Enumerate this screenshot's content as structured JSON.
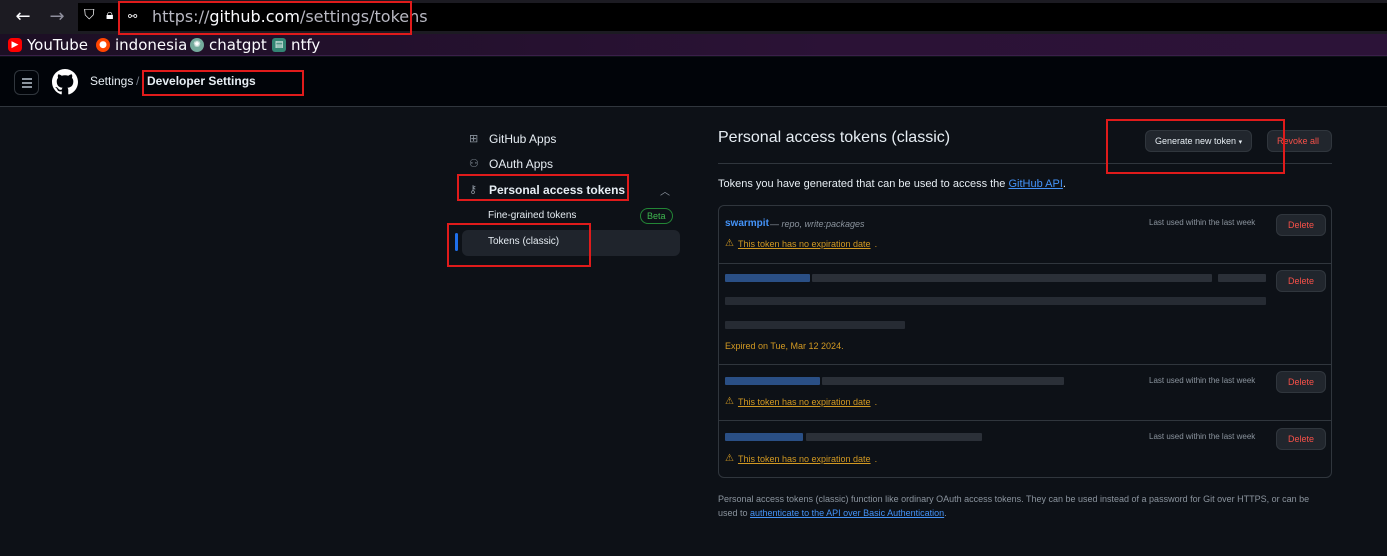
{
  "browser": {
    "url_prefix": "https://",
    "url_host": "github.com",
    "url_path": "/settings/tokens",
    "bookmarks": [
      "YouTube",
      "indonesia",
      "chatgpt",
      "ntfy"
    ]
  },
  "header": {
    "breadcrumb_settings": "Settings",
    "breadcrumb_sep": "/",
    "breadcrumb_current": "Developer Settings"
  },
  "sidebar": {
    "items": [
      {
        "label": "GitHub Apps"
      },
      {
        "label": "OAuth Apps"
      },
      {
        "label": "Personal access tokens"
      }
    ],
    "sub_items": [
      {
        "label": "Fine-grained tokens",
        "badge": "Beta"
      },
      {
        "label": "Tokens (classic)"
      }
    ]
  },
  "main": {
    "title": "Personal access tokens (classic)",
    "generate_button": "Generate new token",
    "revoke_button": "Revoke all",
    "intro_text": "Tokens you have generated that can be used to access the ",
    "intro_link": "GitHub API",
    "intro_end": ".",
    "tokens": [
      {
        "name": "swarmpit",
        "scopes": "— repo, write:packages",
        "last_used": "Last used within the last week",
        "warning": "This token has no expiration date",
        "delete": "Delete"
      },
      {
        "expired": "Expired on Tue, Mar 12 2024.",
        "delete": "Delete"
      },
      {
        "last_used": "Last used within the last week",
        "warning": "This token has no expiration date",
        "delete": "Delete"
      },
      {
        "last_used": "Last used within the last week",
        "warning": "This token has no expiration date",
        "delete": "Delete"
      }
    ],
    "footer_text": "Personal access tokens (classic) function like ordinary OAuth access tokens. They can be used instead of a password for Git over HTTPS, or can be used to ",
    "footer_link": "authenticate to the API over Basic Authentication",
    "footer_end": "."
  },
  "colors": {
    "background": "#0d1117",
    "accent_link": "#4493f8",
    "warning": "#d29922",
    "danger": "#f85149",
    "annotation_red": "#e01b1b"
  }
}
